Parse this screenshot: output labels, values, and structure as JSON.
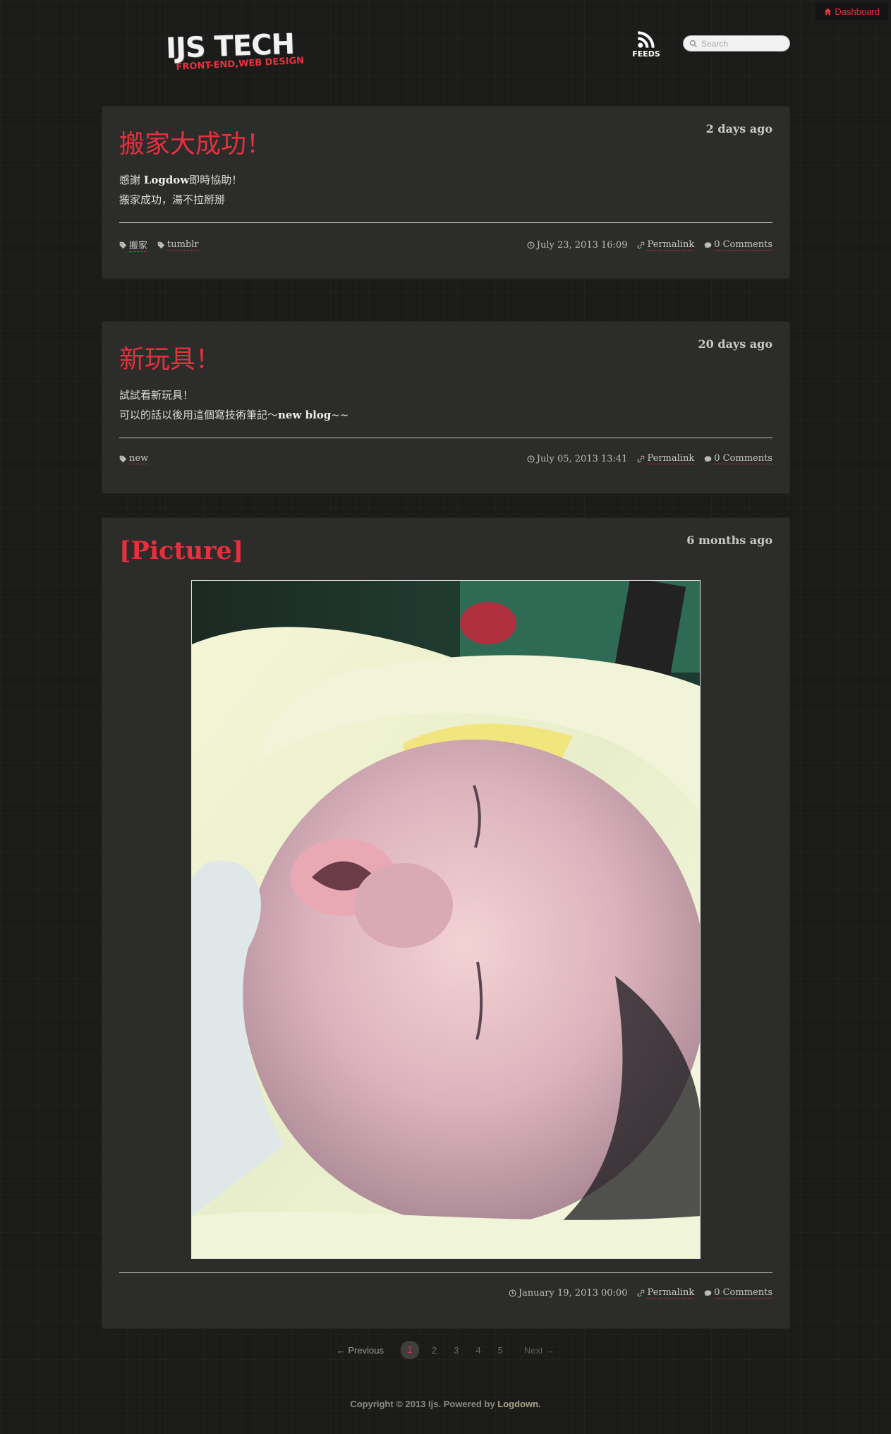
{
  "topbar": {
    "dashboard_label": "Dashboard"
  },
  "header": {
    "logo_text": "IJS TECH",
    "logo_subtitle": "FRONT-END,WEB DESIGN",
    "feeds_label": "FEEDS",
    "search_placeholder": "Search"
  },
  "posts": [
    {
      "title": "搬家大成功！",
      "age": "2 days ago",
      "body_lines": [
        "感謝 ",
        "Logdow",
        "即時協助！",
        "搬家成功，湯不拉掰掰"
      ],
      "tags": [
        "搬家",
        "tumblr"
      ],
      "date": "July 23, 2013 16:09",
      "permalink": "Permalink",
      "comments": "0 Comments"
    },
    {
      "title": "新玩具！",
      "age": "20 days ago",
      "body_lines": [
        "試試看新玩具！",
        "可以的話以後用這個寫技術筆記～",
        "new blog",
        "~~"
      ],
      "tags": [
        "new"
      ],
      "date": "July 05, 2013 13:41",
      "permalink": "Permalink",
      "comments": "0 Comments"
    },
    {
      "title": "[Picture]",
      "age": "6 months ago",
      "date": "January 19, 2013 00:00",
      "permalink": "Permalink",
      "comments": "0 Comments"
    }
  ],
  "pagination": {
    "previous": "← Previous",
    "pages": [
      "1",
      "2",
      "3",
      "4",
      "5"
    ],
    "current": "1",
    "next": "Next →"
  },
  "footer": {
    "copyright": "Copyright © 2013 Ijs. Powered by ",
    "powered_link": "Logdown",
    "end": "."
  },
  "colors": {
    "accent": "#e6303e",
    "panel": "#2c2c2b",
    "background": "#1b1b19"
  }
}
